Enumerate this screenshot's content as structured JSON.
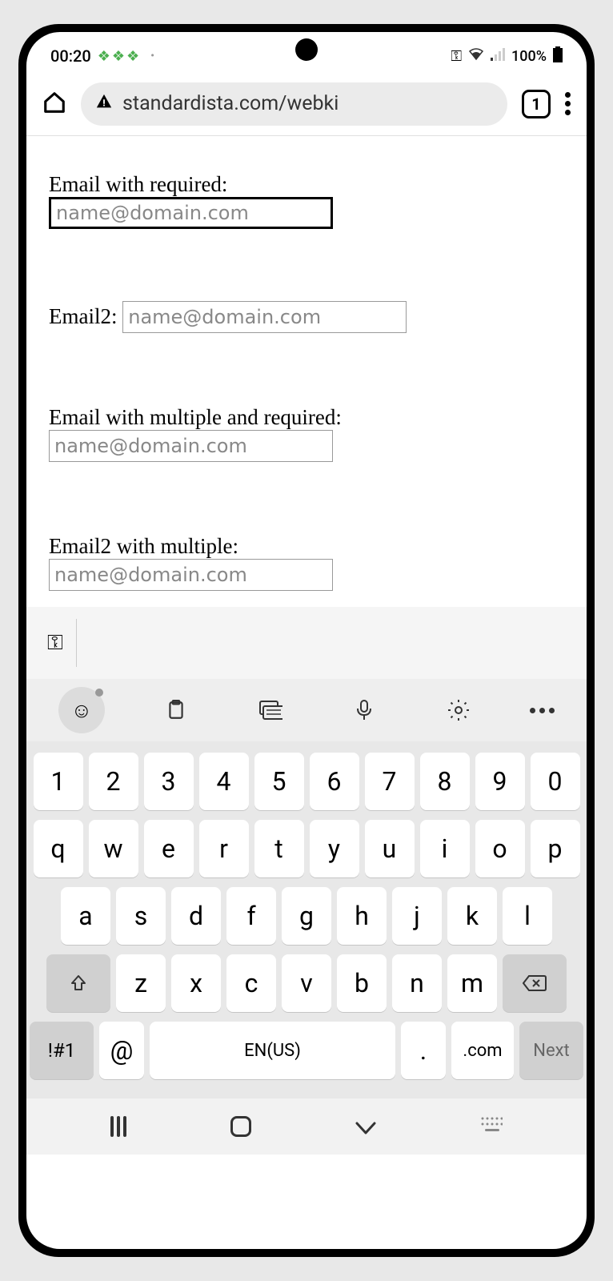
{
  "status": {
    "time": "00:20",
    "battery": "100%"
  },
  "browser": {
    "url": "standardista.com/webki",
    "tab_count": "1"
  },
  "form": {
    "field1": {
      "label": "Email with required:",
      "placeholder": "name@domain.com"
    },
    "field2": {
      "label": "Email2:",
      "placeholder": "name@domain.com"
    },
    "field3": {
      "label": "Email with multiple and required:",
      "placeholder": "name@domain.com"
    },
    "field4": {
      "label": "Email2 with multiple:",
      "placeholder": "name@domain.com"
    }
  },
  "keyboard": {
    "row1": [
      "1",
      "2",
      "3",
      "4",
      "5",
      "6",
      "7",
      "8",
      "9",
      "0"
    ],
    "row2": [
      "q",
      "w",
      "e",
      "r",
      "t",
      "y",
      "u",
      "i",
      "o",
      "p"
    ],
    "row3": [
      "a",
      "s",
      "d",
      "f",
      "g",
      "h",
      "j",
      "k",
      "l"
    ],
    "row4": [
      "z",
      "x",
      "c",
      "v",
      "b",
      "n",
      "m"
    ],
    "sym": "!#1",
    "at": "@",
    "space": "EN(US)",
    "dot": ".",
    "com": ".com",
    "next": "Next"
  }
}
